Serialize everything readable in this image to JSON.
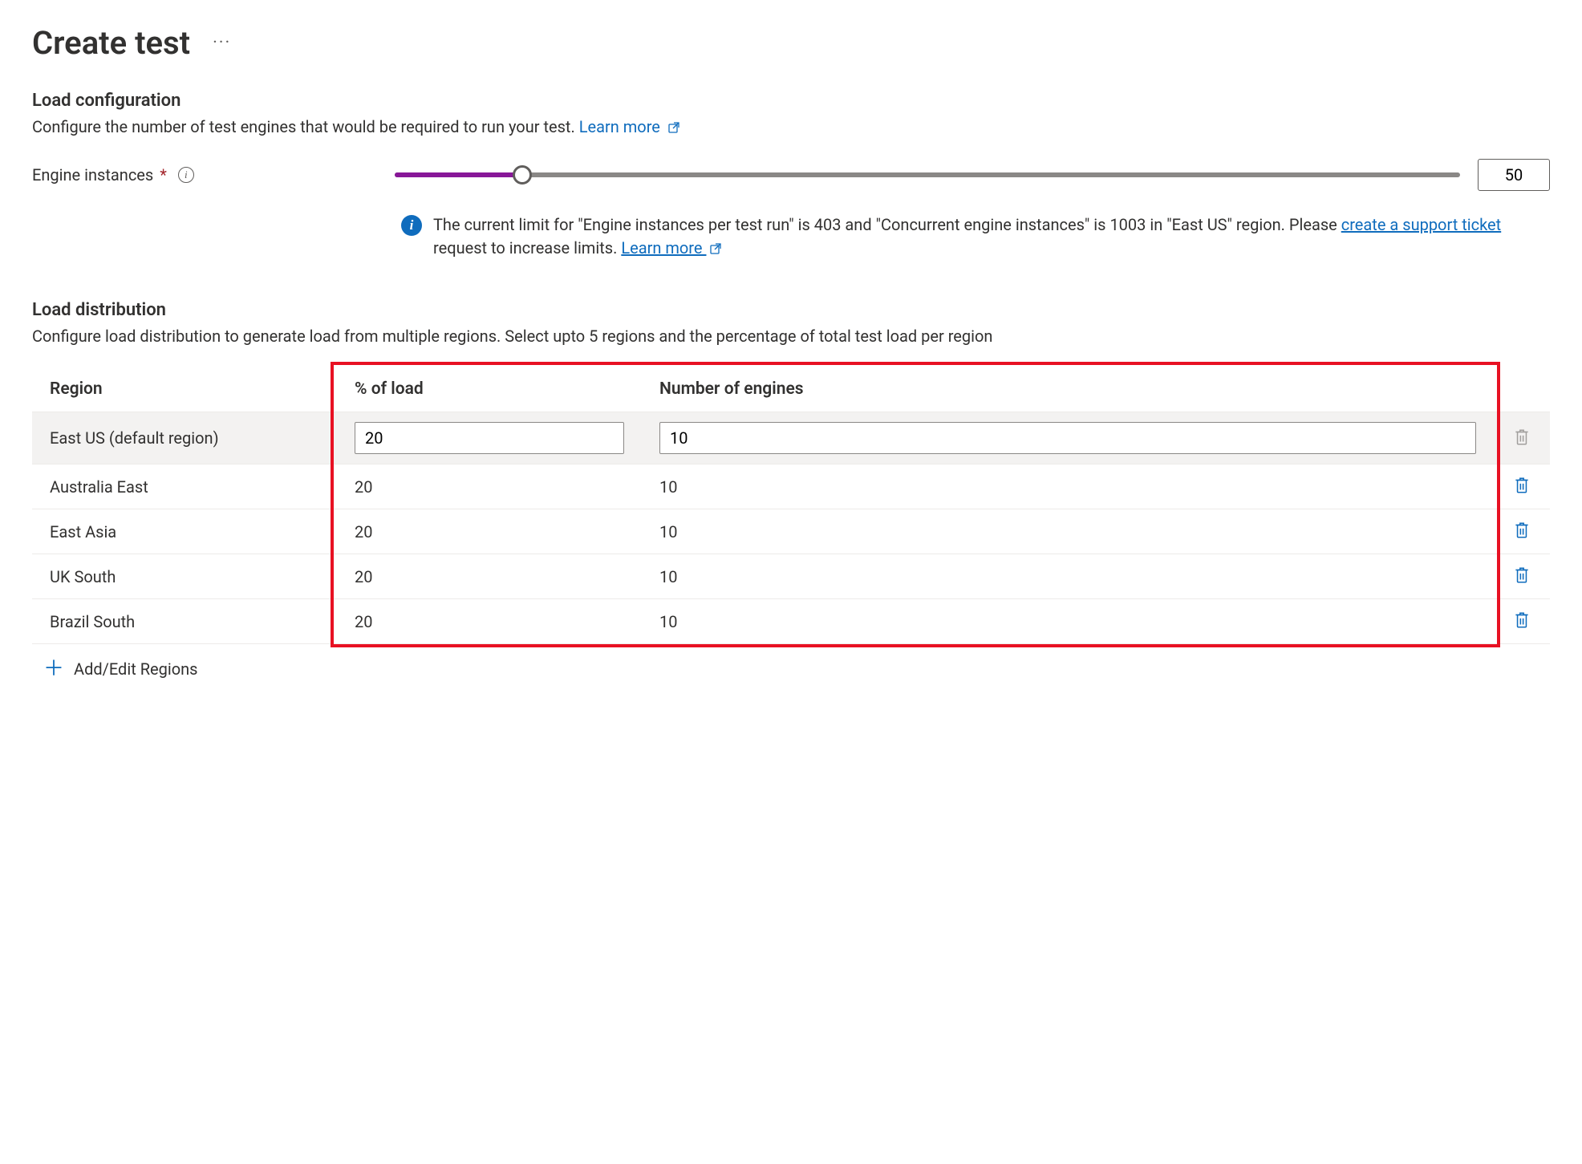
{
  "page": {
    "title": "Create test"
  },
  "load_config": {
    "heading": "Load configuration",
    "subtext": "Configure the number of test engines that would be required to run your test. ",
    "learn_more": "Learn more",
    "engine_label": "Engine instances",
    "engine_value": "50",
    "slider_percent": 12
  },
  "info_banner": {
    "text_a": "The current limit for \"Engine instances per test run\" is 403 and \"Concurrent engine instances\" is 1003 in \"East US\" region. Please ",
    "ticket_link": "create a support ticket",
    "text_b": " request to increase limits. ",
    "learn_more": "Learn more"
  },
  "load_dist": {
    "heading": "Load distribution",
    "subtext": "Configure load distribution to generate load from multiple regions. Select upto 5 regions and the percentage of total test load per region",
    "headers": {
      "region": "Region",
      "percent": "% of load",
      "engines": "Number of engines"
    },
    "rows": [
      {
        "region": "East US (default region)",
        "percent": "20",
        "engines": "10",
        "editable": true,
        "deletable": false
      },
      {
        "region": "Australia East",
        "percent": "20",
        "engines": "10",
        "editable": false,
        "deletable": true
      },
      {
        "region": "East Asia",
        "percent": "20",
        "engines": "10",
        "editable": false,
        "deletable": true
      },
      {
        "region": "UK South",
        "percent": "20",
        "engines": "10",
        "editable": false,
        "deletable": true
      },
      {
        "region": "Brazil South",
        "percent": "20",
        "engines": "10",
        "editable": false,
        "deletable": true
      }
    ],
    "add_label": "Add/Edit Regions"
  },
  "colors": {
    "accent": "#0f6cbd",
    "slider_fill": "#881798",
    "highlight_border": "#e81123"
  }
}
